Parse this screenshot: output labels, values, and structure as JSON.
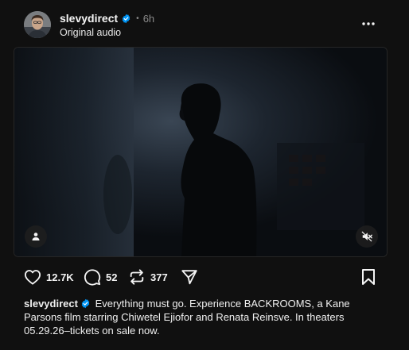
{
  "post": {
    "username": "slevydirect",
    "separator": "•",
    "time_ago": "6h",
    "subtitle": "Original audio",
    "more_icon": "more-horizontal-icon",
    "verified_color": "#0095f6"
  },
  "media": {
    "type": "video",
    "tag_icon": "person-tag-icon",
    "mute_icon": "volume-muted-icon"
  },
  "actions": {
    "likes": "12.7K",
    "comments": "52",
    "reposts": "377",
    "like_icon": "heart-icon",
    "comment_icon": "comment-icon",
    "repost_icon": "repost-icon",
    "share_icon": "send-icon",
    "save_icon": "bookmark-icon"
  },
  "caption": {
    "username": "slevydirect",
    "text": "Everything must go. Experience BACKROOMS, a Kane Parsons film starring Chiwetel Ejiofor and Renata Reinsve. In theaters 05.29.26–tickets on sale now."
  }
}
